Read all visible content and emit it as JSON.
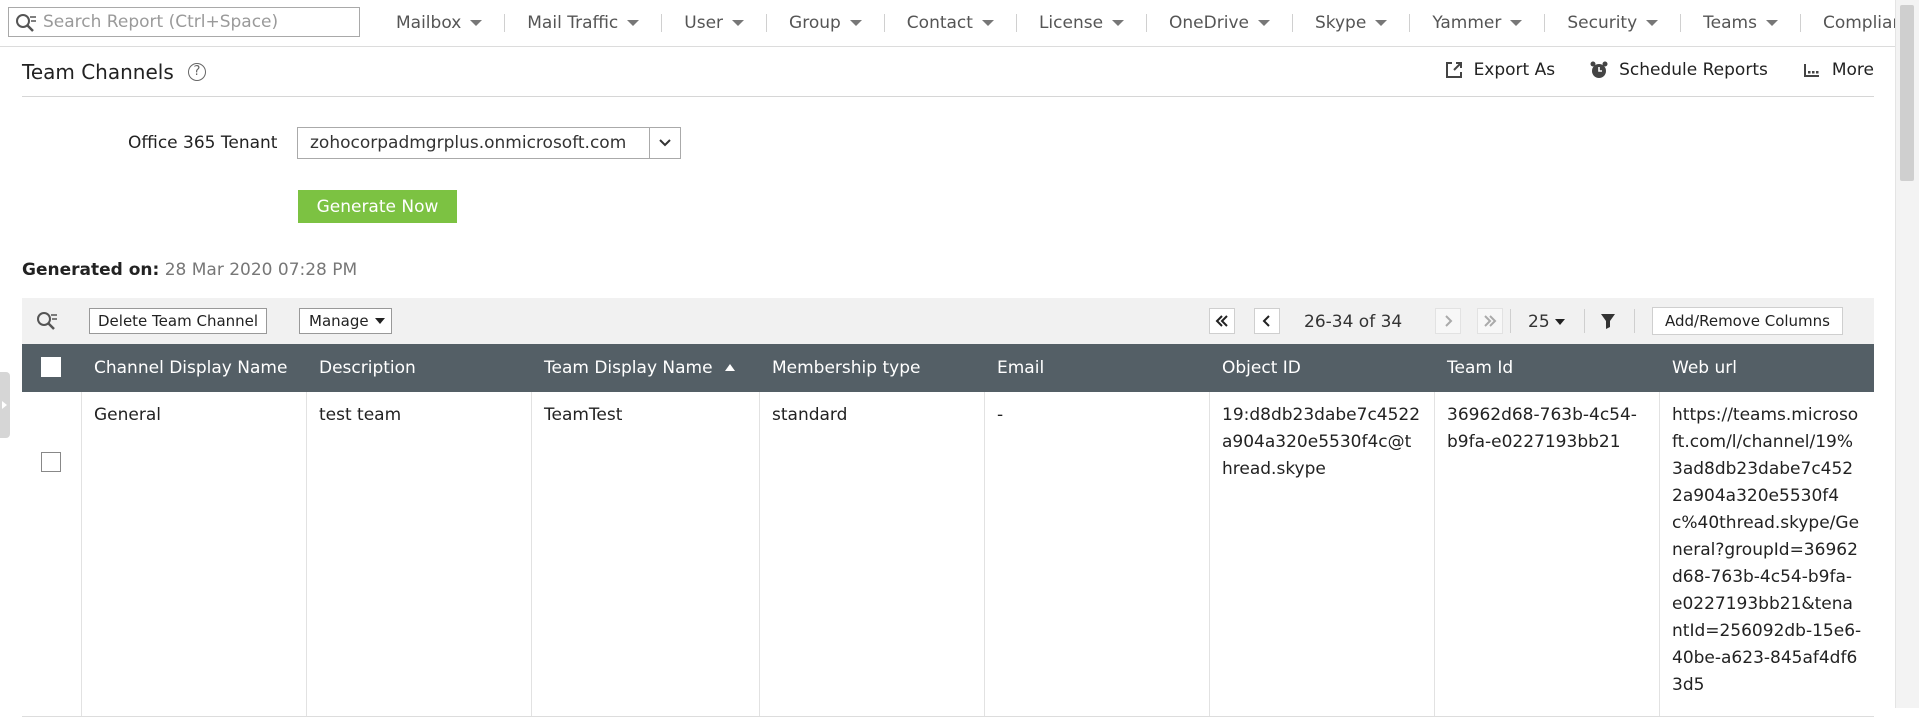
{
  "search": {
    "placeholder": "Search Report (Ctrl+Space)"
  },
  "nav": {
    "menus": [
      "Mailbox",
      "Mail Traffic",
      "User",
      "Group",
      "Contact",
      "License",
      "OneDrive",
      "Skype",
      "Yammer",
      "Security",
      "Teams",
      "Complian"
    ]
  },
  "page": {
    "title": "Team Channels",
    "help_glyph": "?",
    "actions": {
      "export": "Export As",
      "schedule": "Schedule Reports",
      "more": "More"
    }
  },
  "form": {
    "tenant_label": "Office 365 Tenant",
    "tenant_value": "zohocorpadmgrplus.onmicrosoft.com",
    "generate_label": "Generate Now"
  },
  "generated": {
    "label": "Generated on:",
    "value": "28 Mar 2020 07:28 PM"
  },
  "toolbar": {
    "delete_label": "Delete Team Channel",
    "manage_label": "Manage",
    "pager_text": "26-34 of 34",
    "page_size": "25",
    "columns_label": "Add/Remove Columns"
  },
  "table": {
    "columns": [
      "Channel Display Name",
      "Description",
      "Team Display Name",
      "Membership type",
      "Email",
      "Object ID",
      "Team Id",
      "Web url"
    ],
    "sorted_column": "Team Display Name",
    "sort_direction": "ascending",
    "rows": [
      {
        "channel": "General",
        "description": "test team",
        "team": "TeamTest",
        "membership": "standard",
        "email": "-",
        "object_id": "19:d8db23dabe7c4522a904a320e5530f4c@thread.skype",
        "team_id": "36962d68-763b-4c54-b9fa-e0227193bb21",
        "web_url": "https://teams.microsoft.com/l/channel/19%3ad8db23dabe7c4522a904a320e5530f4c%40thread.skype/General?groupId=36962d68-763b-4c54-b9fa-e0227193bb21&tenantId=256092db-15e6-40be-a623-845af4df63d5"
      }
    ]
  },
  "colors": {
    "header_bg": "#545f66",
    "generate_button": "#7cc242",
    "toolbar_bg": "#f1f1f1"
  }
}
